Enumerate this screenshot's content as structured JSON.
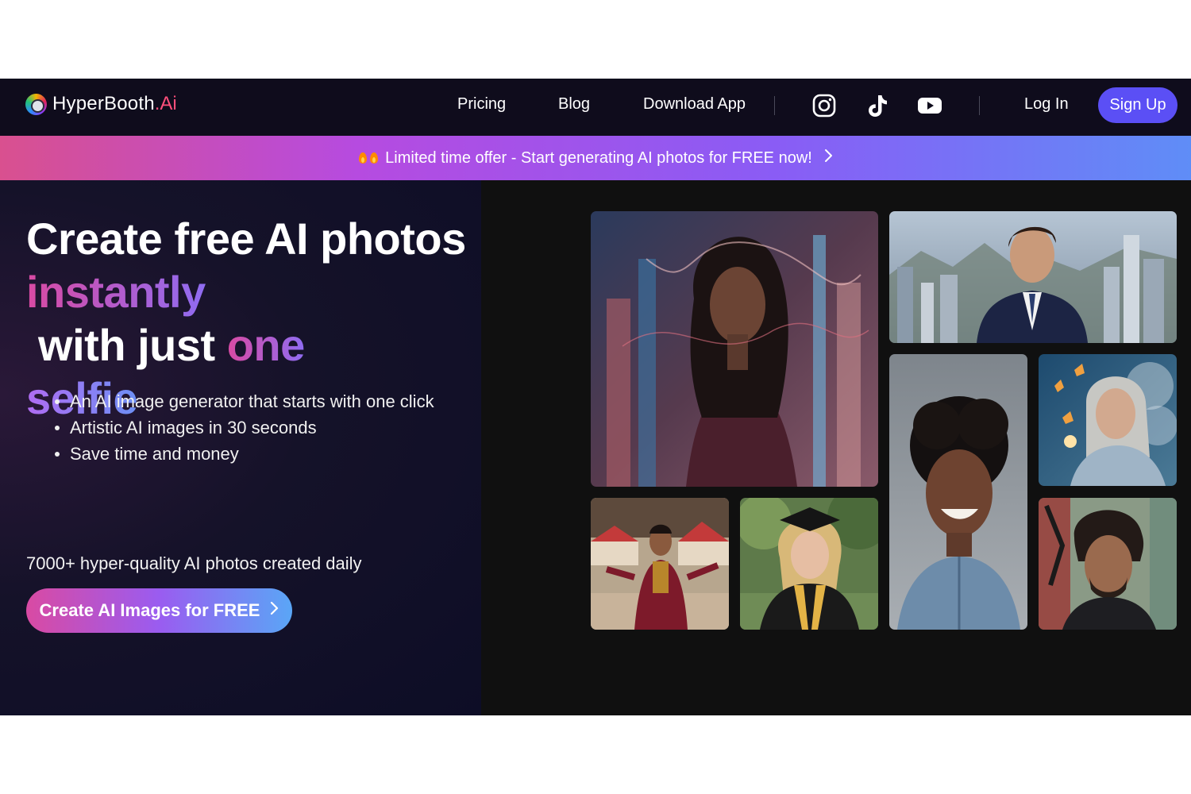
{
  "nav": {
    "brand": "HyperBooth",
    "brand_suffix": ".Ai",
    "links": [
      "Pricing",
      "Blog",
      "Download App"
    ],
    "login": "Log In",
    "signup": "Sign Up"
  },
  "promo": {
    "text": "Limited time offer - Start generating AI photos for FREE now!"
  },
  "hero": {
    "headline_line1": "Create free AI photos",
    "headline_word_instantly": "instantly",
    "headline_mid": " with just ",
    "headline_word_one": "one",
    "headline_word_selfie": "selfie",
    "bullets": [
      "An AI image generator that starts with one click",
      "Artistic AI images in 30 seconds",
      "Save time and money"
    ],
    "stat": "7000+ hyper-quality AI photos created daily",
    "cta": "Create AI Images for FREE"
  },
  "icons": {
    "instagram": "instagram-icon",
    "tiktok": "tiktok-icon",
    "youtube": "youtube-icon",
    "flame": "fire-icon",
    "chevron": "chevron-right-icon"
  },
  "colors": {
    "signup_bg": "#5b4ff5",
    "brand_accent": "#ff4f7b",
    "gradient_pink": "#d94aa3",
    "gradient_purple": "#8f6cf2",
    "gradient_blue": "#5aa6f6"
  },
  "gallery": [
    {
      "id": "cyber-woman"
    },
    {
      "id": "businessman-city"
    },
    {
      "id": "curly-hair-woman"
    },
    {
      "id": "silver-hair-woman-butterflies"
    },
    {
      "id": "ringmaster-man"
    },
    {
      "id": "graduate-woman"
    },
    {
      "id": "artist-man"
    }
  ]
}
